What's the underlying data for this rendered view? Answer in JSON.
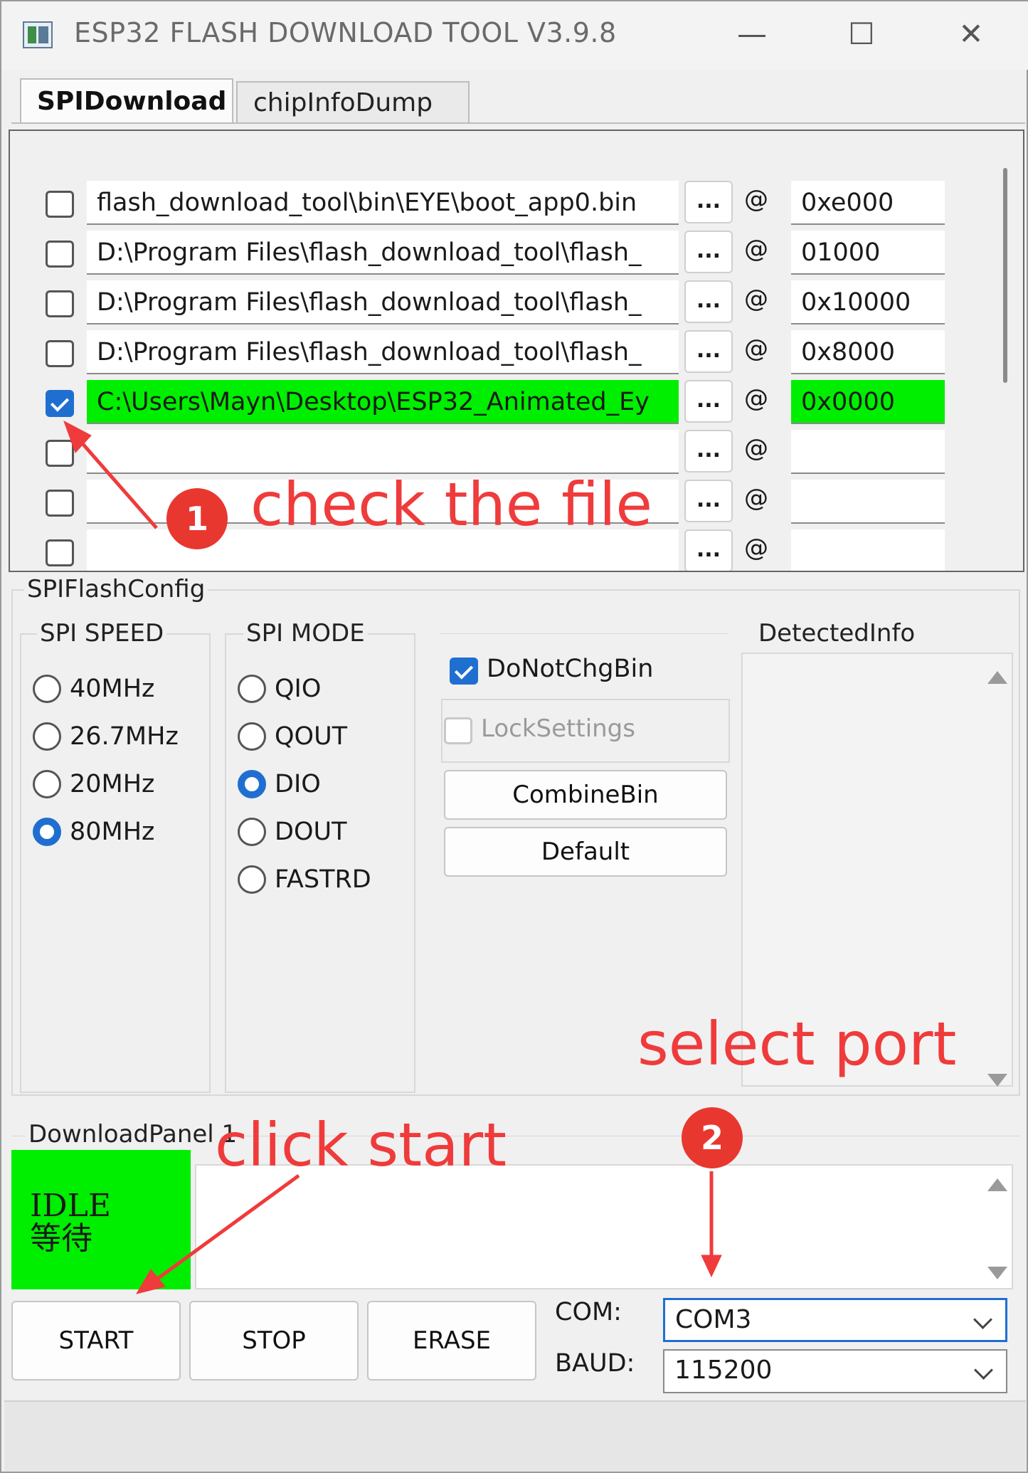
{
  "window": {
    "title": "ESP32 FLASH DOWNLOAD TOOL V3.9.8",
    "minimize_glyph": "—",
    "maximize_glyph": "☐",
    "close_glyph": "✕"
  },
  "tabs": [
    {
      "label": "SPIDownload",
      "active": true
    },
    {
      "label": "chipInfoDump",
      "active": false
    }
  ],
  "files": [
    {
      "checked": false,
      "path": "flash_download_tool\\bin\\EYE\\boot_app0.bin",
      "addr": "0xe000",
      "highlight": false
    },
    {
      "checked": false,
      "path": "D:\\Program Files\\flash_download_tool\\flash_",
      "addr": "01000",
      "highlight": false
    },
    {
      "checked": false,
      "path": "D:\\Program Files\\flash_download_tool\\flash_",
      "addr": "0x10000",
      "highlight": false
    },
    {
      "checked": false,
      "path": "D:\\Program Files\\flash_download_tool\\flash_",
      "addr": "0x8000",
      "highlight": false
    },
    {
      "checked": true,
      "path": "C:\\Users\\Mayn\\Desktop\\ESP32_Animated_Ey",
      "addr": "0x0000",
      "highlight": true
    },
    {
      "checked": false,
      "path": "",
      "addr": "",
      "highlight": false
    },
    {
      "checked": false,
      "path": "",
      "addr": "",
      "highlight": false
    },
    {
      "checked": false,
      "path": "",
      "addr": "",
      "highlight": false
    }
  ],
  "browse_label": "...",
  "at_label": "@",
  "config": {
    "title": "SPIFlashConfig",
    "spi_speed": {
      "title": "SPI SPEED",
      "options": [
        "40MHz",
        "26.7MHz",
        "20MHz",
        "80MHz"
      ],
      "selected": "80MHz"
    },
    "spi_mode": {
      "title": "SPI MODE",
      "options": [
        "QIO",
        "QOUT",
        "DIO",
        "DOUT",
        "FASTRD"
      ],
      "selected": "DIO"
    },
    "do_not_chg_bin": {
      "label": "DoNotChgBin",
      "checked": true
    },
    "lock_settings": {
      "label": "LockSettings",
      "checked": false
    },
    "combine_bin_label": "CombineBin",
    "default_label": "Default",
    "detected_info_title": "DetectedInfo"
  },
  "download_panel": {
    "title": "DownloadPanel 1",
    "status_en": "IDLE",
    "status_cn": "等待",
    "start_label": "START",
    "stop_label": "STOP",
    "erase_label": "ERASE",
    "com_label": "COM:",
    "com_value": "COM3",
    "baud_label": "BAUD:",
    "baud_value": "115200"
  },
  "annotations": {
    "step1_number": "1",
    "step1_text": "check the file",
    "step2_number": "2",
    "select_port_text": "select port",
    "click_start_text": "click start",
    "color": "#ef3b3b"
  },
  "colors": {
    "highlight_green": "#00ee00",
    "accent_blue": "#1f6fd1"
  }
}
